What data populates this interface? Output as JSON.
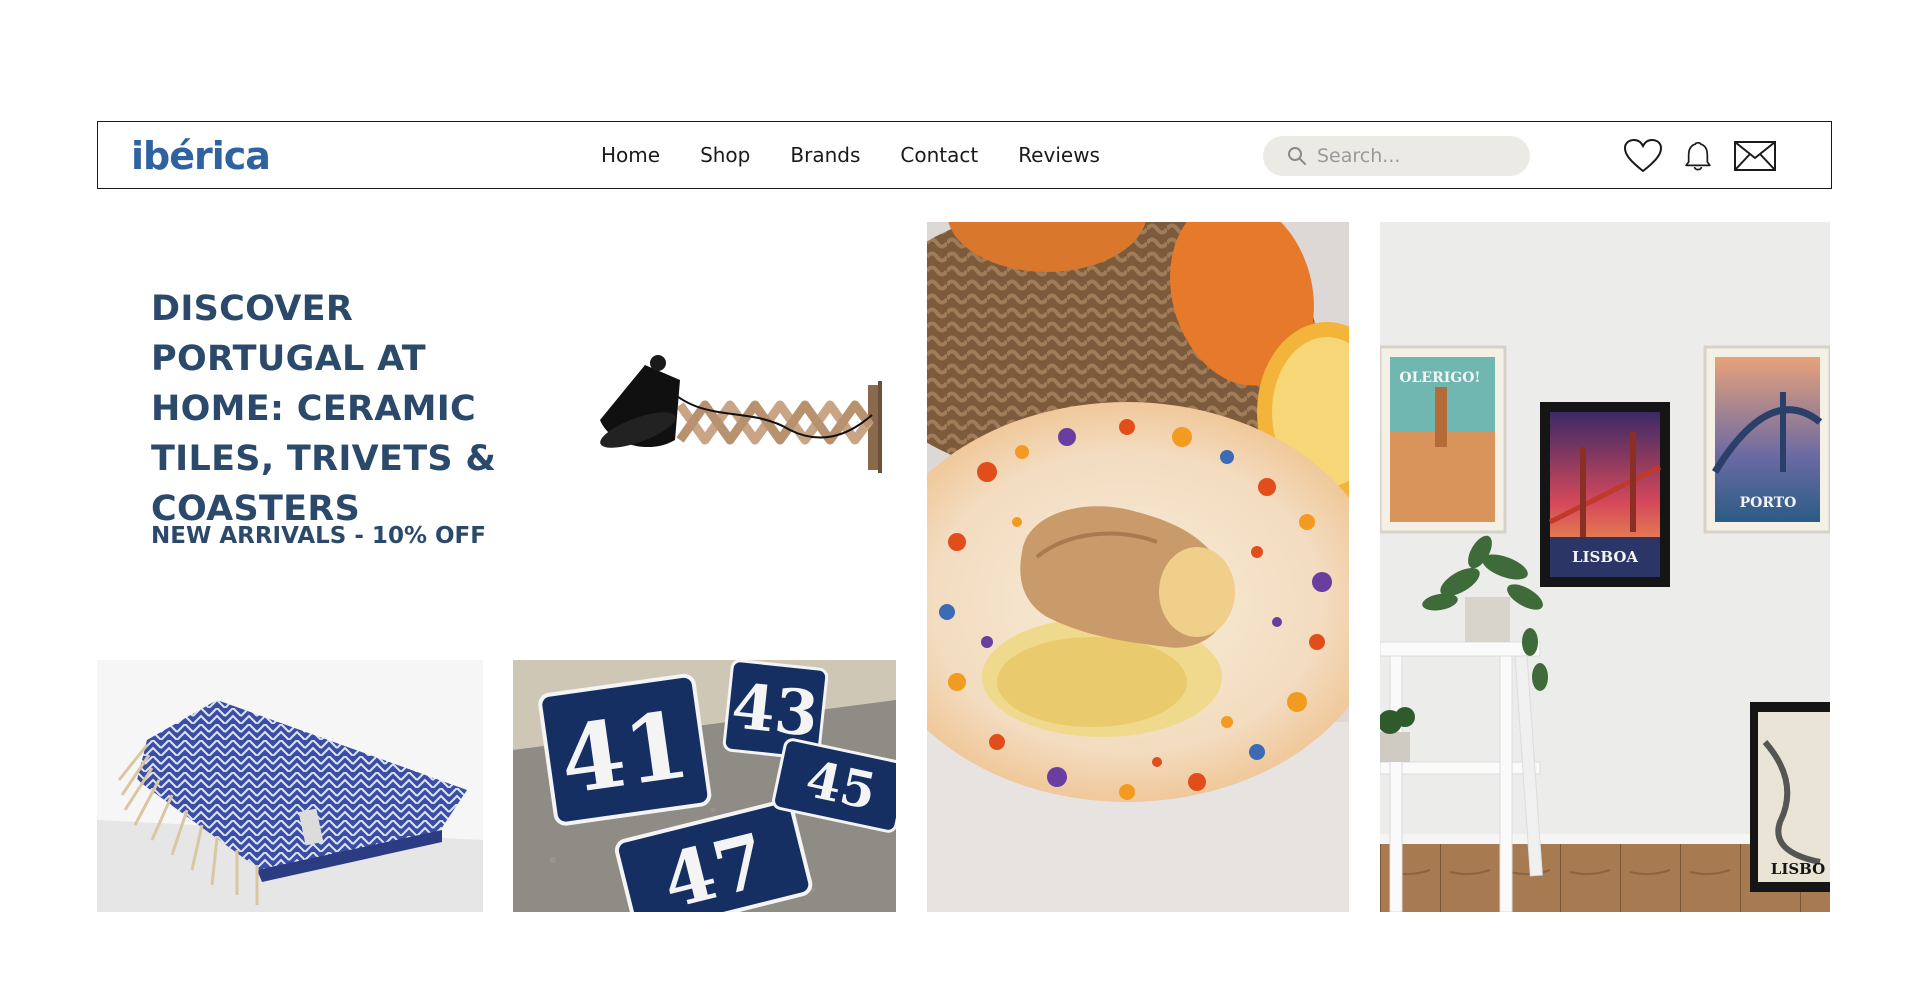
{
  "header": {
    "logo_text": "ibérica",
    "nav": [
      "Home",
      "Shop",
      "Brands",
      "Contact",
      "Reviews"
    ],
    "search_placeholder": "Search...",
    "icons": [
      "heart-icon",
      "bell-icon",
      "mail-icon"
    ]
  },
  "hero": {
    "title": "DISCOVER PORTUGAL AT HOME: CERAMIC TILES, TRIVETS & COASTERS",
    "subtitle": "NEW ARRIVALS - 10% OFF"
  },
  "tiles": {
    "plaque_numbers": [
      "41",
      "43",
      "47",
      "45"
    ],
    "poster_labels": [
      "OLERIGO!",
      "LISBOA",
      "PORTO",
      "LISBO"
    ]
  },
  "colors": {
    "brand_blue": "#2f62a0",
    "heading_navy": "#2b4a6b",
    "search_bg": "#eceae5",
    "plaque_navy": "#152f63"
  }
}
